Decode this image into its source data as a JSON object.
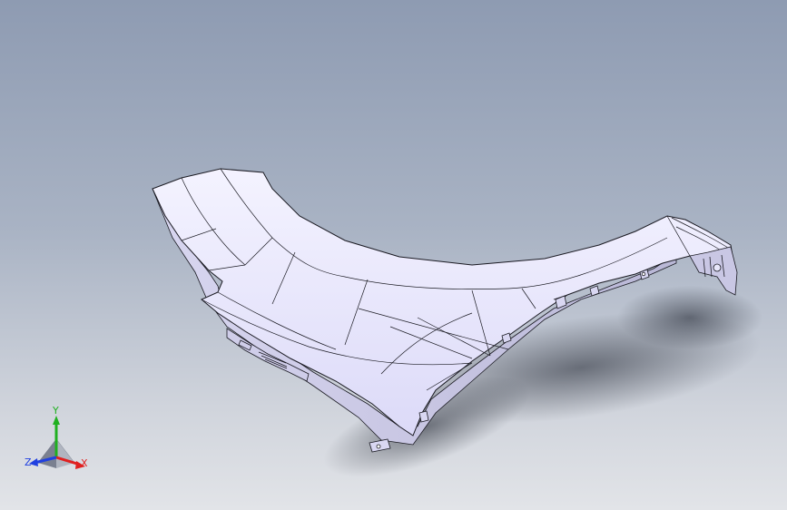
{
  "viewport": {
    "background_top": "#8e9bb2",
    "background_bottom": "#e2e4e8"
  },
  "model": {
    "part": "fender-surface",
    "fill_color": "#ecebff",
    "edge_color": "#1a1a22"
  },
  "triad": {
    "x_label": "X",
    "y_label": "Y",
    "z_label": "Z",
    "x_color": "#e02020",
    "y_color": "#20b020",
    "z_color": "#2040e0"
  }
}
